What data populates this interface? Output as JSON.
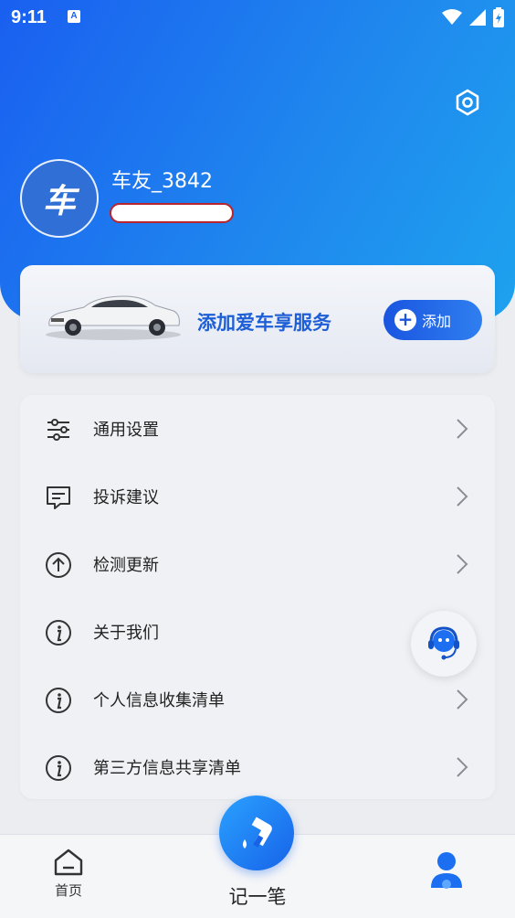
{
  "status_bar": {
    "time": "9:11",
    "notification_icon": "A"
  },
  "profile": {
    "username": "车友_3842",
    "avatar_text": "车"
  },
  "car_card": {
    "title": "添加爱车享服务",
    "add_label": "添加"
  },
  "menu": {
    "items": [
      {
        "label": "通用设置",
        "icon": "sliders-icon"
      },
      {
        "label": "投诉建议",
        "icon": "feedback-icon"
      },
      {
        "label": "检测更新",
        "icon": "upload-arrow-icon"
      },
      {
        "label": "关于我们",
        "icon": "info-icon"
      },
      {
        "label": "个人信息收集清单",
        "icon": "info-icon"
      },
      {
        "label": "第三方信息共享清单",
        "icon": "info-icon"
      }
    ]
  },
  "bottom_nav": {
    "home_label": "首页",
    "record_label": "记一笔"
  },
  "colors": {
    "primary": "#1a5ff0",
    "accent": "#1e5fd7"
  }
}
